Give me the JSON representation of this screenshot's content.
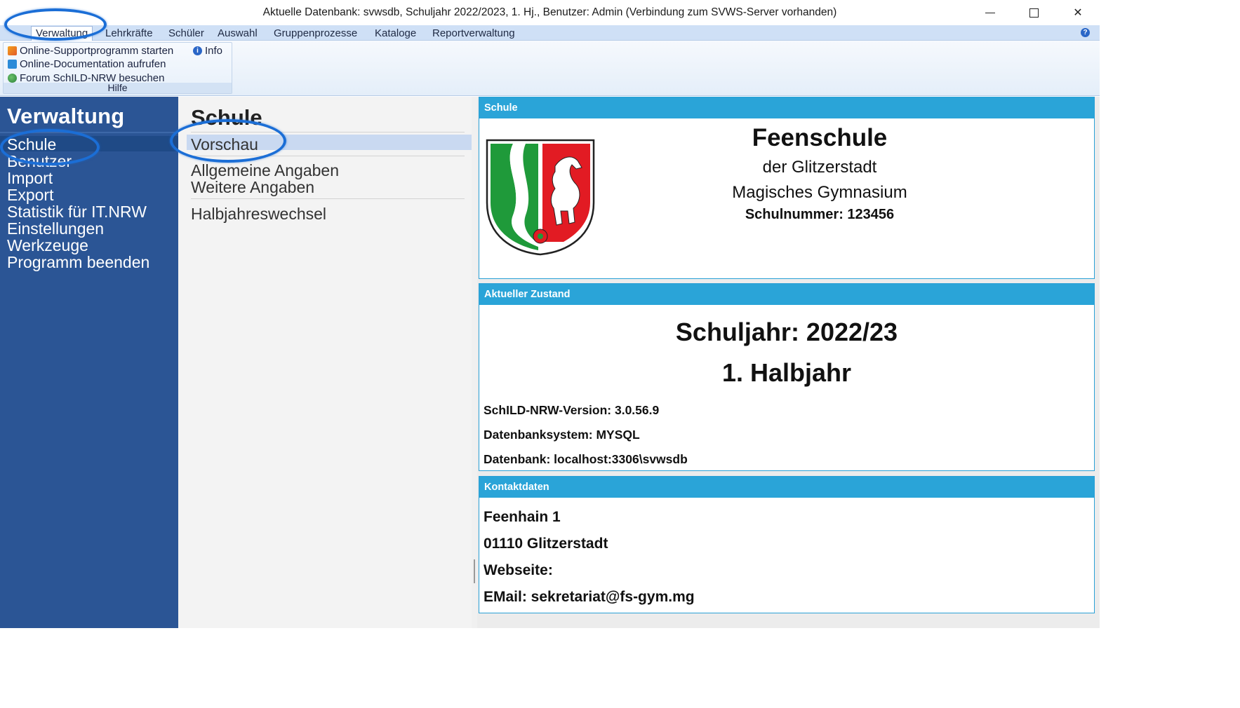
{
  "window": {
    "title": "Aktuelle Datenbank: svwsdb, Schuljahr 2022/2023, 1. Hj., Benutzer: Admin (Verbindung zum SVWS-Server vorhanden)",
    "minimize_icon": "minimize-icon",
    "maximize_icon": "maximize-icon",
    "close_icon": "close-icon",
    "close_glyph": "✕"
  },
  "menubar": {
    "items": [
      "Verwaltung",
      "Lehrkräfte",
      "Schüler",
      "Auswahl",
      "Gruppenprozesse",
      "Kataloge",
      "Reportverwaltung"
    ],
    "active": "Verwaltung",
    "help_glyph": "?"
  },
  "ribbon": {
    "group_label": "Hilfe",
    "support_label": "Online-Supportprogramm starten",
    "doc_label": "Online-Documentation aufrufen",
    "forum_label": "Forum SchILD-NRW besuchen",
    "info_label": "Info",
    "info_glyph": "i"
  },
  "leftnav": {
    "title": "Verwaltung",
    "items": [
      "Schule",
      "Benutzer",
      "Import",
      "Export",
      "Statistik für IT.NRW",
      "Einstellungen",
      "Werkzeuge",
      "Programm beenden"
    ],
    "selected": "Schule"
  },
  "subnav": {
    "title": "Schule",
    "items": [
      "Vorschau",
      "Allgemeine Angaben",
      "Weitere Angaben",
      "Halbjahreswechsel"
    ],
    "selected": "Vorschau"
  },
  "panels": {
    "schule": {
      "header": "Schule",
      "name": "Feenschule",
      "line1": "der Glitzerstadt",
      "line2": "Magisches Gymnasium",
      "number": "Schulnummer: 123456"
    },
    "zustand": {
      "header": "Aktueller Zustand",
      "schuljahr": "Schuljahr: 2022/23",
      "halbjahr": "1. Halbjahr",
      "version": "SchILD-NRW-Version: 3.0.56.9",
      "dbsystem": "Datenbanksystem: MYSQL",
      "database": "Datenbank: localhost:3306\\svwsdb"
    },
    "kontakt": {
      "header": "Kontaktdaten",
      "street": "Feenhain 1",
      "city": "01110 Glitzerstadt",
      "website": "Webseite:",
      "email": "EMail: sekretariat@fs-gym.mg"
    }
  },
  "colors": {
    "nav_bg": "#2b5595",
    "panel_header": "#2aa4d8",
    "annotation": "#1b6ed6"
  }
}
